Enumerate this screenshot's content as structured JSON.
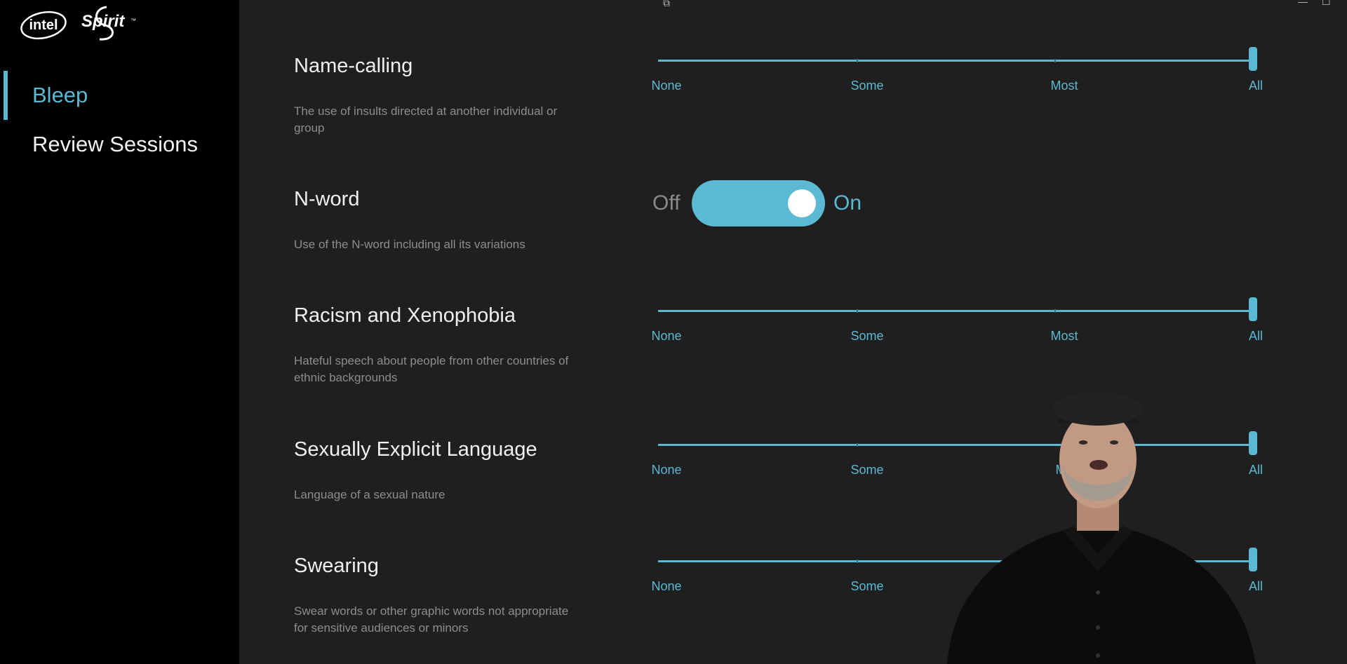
{
  "brand": {
    "logo_text": "intel",
    "product_text": "Spirit",
    "accent_color": "#5cb9d3"
  },
  "sidebar": {
    "items": [
      {
        "label": "Bleep",
        "active": true
      },
      {
        "label": "Review Sessions",
        "active": false
      }
    ]
  },
  "window_controls": {
    "minimize_icon": "minimize-icon",
    "maximize_icon": "maximize-icon"
  },
  "settings": [
    {
      "title": "Name-calling",
      "description": "The use of insults directed at another individual or group",
      "control": "slider",
      "levels": [
        "None",
        "Some",
        "Most",
        "All"
      ],
      "value": "All"
    },
    {
      "title": "N-word",
      "description": "Use of the N-word including all its variations",
      "control": "toggle",
      "off_label": "Off",
      "on_label": "On",
      "value": "On"
    },
    {
      "title": "Racism and Xenophobia",
      "description": "Hateful speech about people from other countries of ethnic backgrounds",
      "control": "slider",
      "levels": [
        "None",
        "Some",
        "Most",
        "All"
      ],
      "value": "All"
    },
    {
      "title": "Sexually Explicit Language",
      "description": "Language of a sexual nature",
      "control": "slider",
      "levels": [
        "None",
        "Some",
        "Mo",
        "All"
      ],
      "value": "All"
    },
    {
      "title": "Swearing",
      "description": "Swear words or other graphic words not appropriate for sensitive audiences or minors",
      "control": "slider",
      "levels": [
        "None",
        "Some",
        "",
        "All"
      ],
      "value": "All"
    }
  ]
}
